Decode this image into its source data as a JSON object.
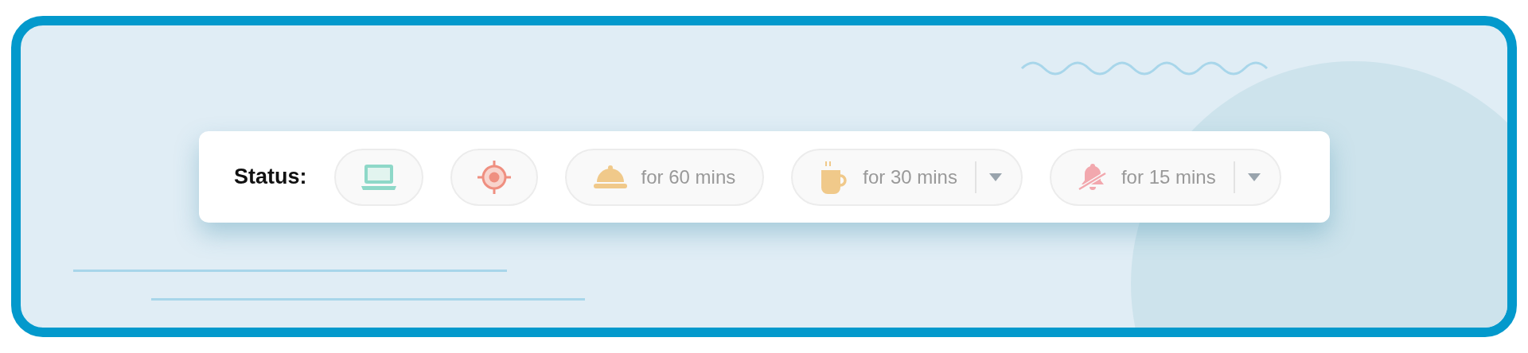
{
  "status_bar": {
    "label": "Status:",
    "buttons": [
      {
        "kind": "icon"
      },
      {
        "kind": "icon"
      },
      {
        "kind": "timed",
        "text": "for 60 mins"
      },
      {
        "kind": "dropdown",
        "text": "for 30 mins"
      },
      {
        "kind": "dropdown",
        "text": "for 15 mins"
      }
    ]
  }
}
